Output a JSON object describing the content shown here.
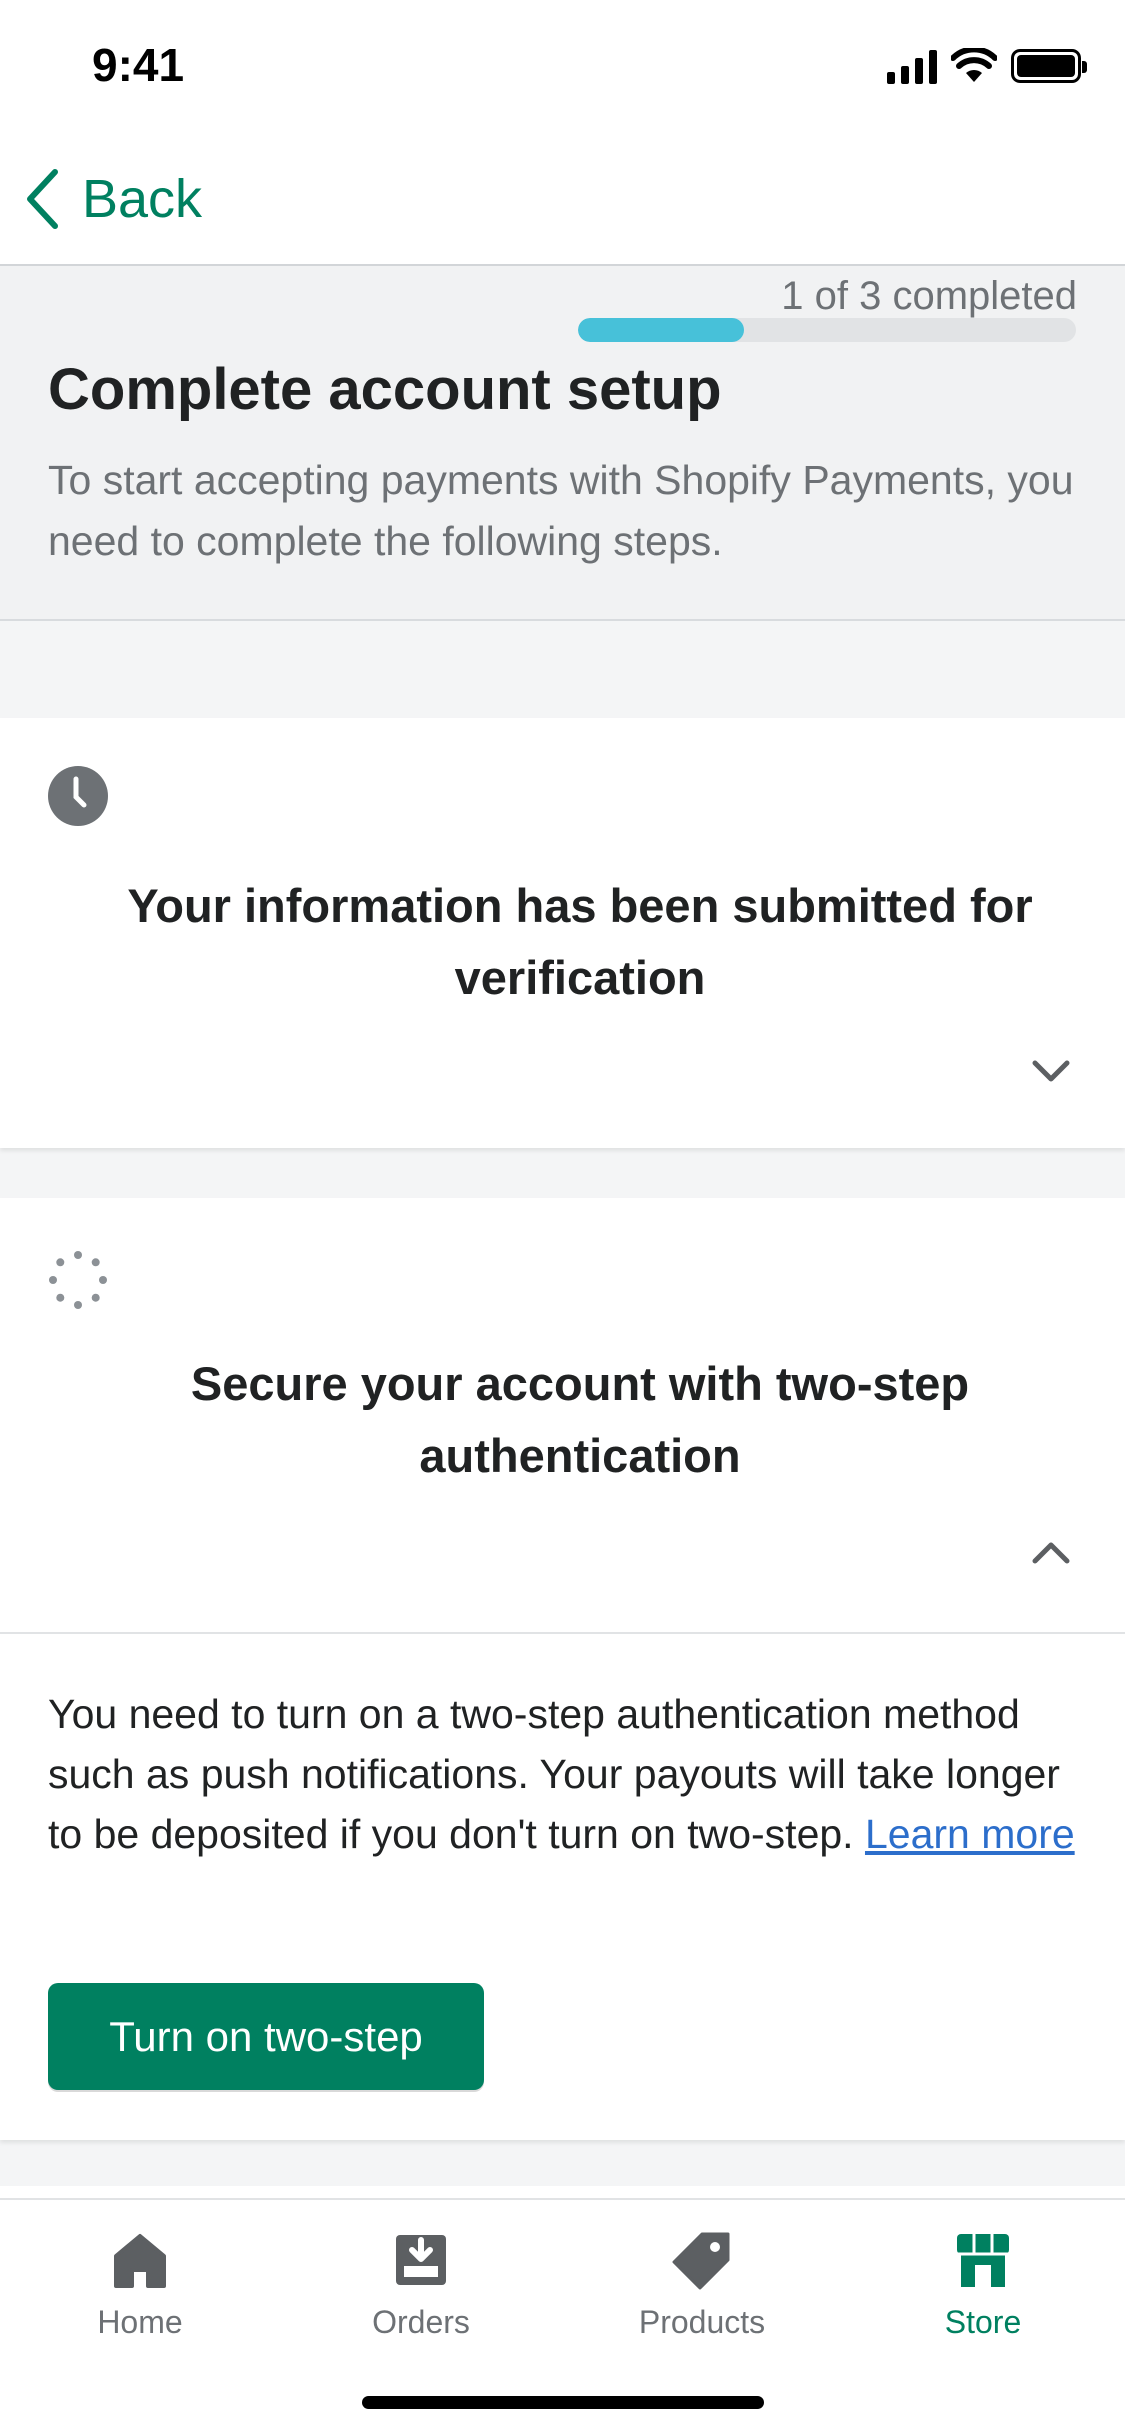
{
  "status_bar": {
    "time": "9:41"
  },
  "nav": {
    "back_label": "Back"
  },
  "header": {
    "progress_text": "1 of 3 completed",
    "progress_completed": 1,
    "progress_total": 3,
    "title": "Complete account setup",
    "subtitle": "To start accepting payments with Shopify Payments, you need to complete the following steps."
  },
  "steps": [
    {
      "icon": "clock-icon",
      "title": "Your information has been submitted for verification",
      "expanded": false
    },
    {
      "icon": "pending-spinner-icon",
      "title": "Secure your account with two-step authentication",
      "expanded": true,
      "body": "You need to turn on a two-step authentication method such as push notifications. Your payouts will take longer to be deposited if you don't turn on two-step.",
      "link_label": "Learn more",
      "button_label": "Turn on two-step"
    }
  ],
  "tabs": [
    {
      "label": "Home",
      "icon": "home-icon",
      "active": false
    },
    {
      "label": "Orders",
      "icon": "orders-icon",
      "active": false
    },
    {
      "label": "Products",
      "icon": "tag-icon",
      "active": false
    },
    {
      "label": "Store",
      "icon": "store-icon",
      "active": true
    }
  ],
  "colors": {
    "primary": "#008060",
    "progress": "#47c1d9",
    "link": "#2c6ecb",
    "muted": "#6d7175"
  }
}
